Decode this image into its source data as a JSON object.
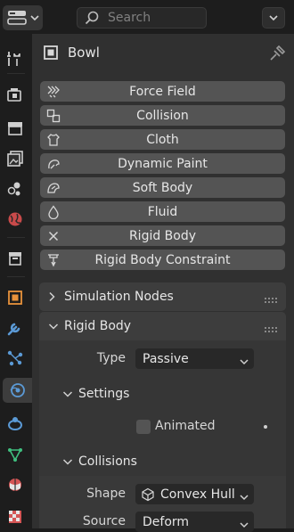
{
  "search": {
    "placeholder": "Search"
  },
  "context": {
    "object_name": "Bowl"
  },
  "physics_buttons": [
    {
      "label": "Force Field",
      "icon": "force-field-icon"
    },
    {
      "label": "Collision",
      "icon": "collision-icon"
    },
    {
      "label": "Cloth",
      "icon": "cloth-icon"
    },
    {
      "label": "Dynamic Paint",
      "icon": "dynamic-paint-icon"
    },
    {
      "label": "Soft Body",
      "icon": "soft-body-icon"
    },
    {
      "label": "Fluid",
      "icon": "fluid-icon"
    },
    {
      "label": "Rigid Body",
      "icon": "close-x-icon"
    },
    {
      "label": "Rigid Body Constraint",
      "icon": "rigid-body-constraint-icon"
    }
  ],
  "sections": {
    "simulation_nodes": {
      "title": "Simulation Nodes"
    },
    "rigid_body": {
      "title": "Rigid Body",
      "type_label": "Type",
      "type_value": "Passive",
      "settings": {
        "title": "Settings",
        "animated_label": "Animated",
        "animated_checked": false
      },
      "collisions": {
        "title": "Collisions",
        "shape_label": "Shape",
        "shape_value": "Convex Hull",
        "source_label": "Source",
        "source_value": "Deform"
      }
    }
  },
  "sidebar_tabs": [
    "tool-icon",
    "render-icon",
    "output-icon",
    "view-layer-icon",
    "scene-icon",
    "world-icon",
    "collection-icon",
    "object-icon",
    "modifier-icon",
    "particles-icon",
    "physics-icon",
    "constraints-icon",
    "data-icon",
    "material-icon",
    "texture-icon"
  ],
  "colors": {
    "accent": "#4772b3",
    "panel": "#303030",
    "button": "#545454"
  }
}
